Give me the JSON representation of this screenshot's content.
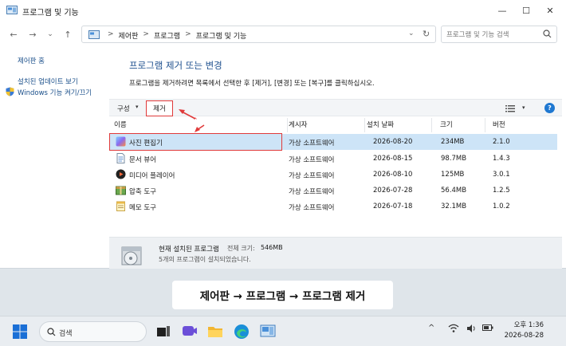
{
  "window": {
    "title": "프로그램 및 기능",
    "minimize_glyph": "—",
    "maximize_glyph": "☐",
    "close_glyph": "✕"
  },
  "nav": {
    "back_glyph": "←",
    "forward_glyph": "→",
    "recent_glyph": "⌄",
    "up_glyph": "↑",
    "breadcrumbs": [
      "제어판",
      "프로그램",
      "프로그램 및 기능"
    ],
    "separator": ">",
    "dropdown_glyph": "⌄",
    "refresh_glyph": "↻",
    "search_placeholder": "프로그램 및 기능 검색"
  },
  "sidebar": {
    "items": [
      {
        "label": "제어판 홈"
      },
      {
        "label": "설치된 업데이트 보기"
      },
      {
        "label": "Windows 기능 켜기/끄기"
      }
    ]
  },
  "main": {
    "heading": "프로그램 제거 또는 변경",
    "description": "프로그램을 제거하려면 목록에서 선택한 후 [제거], [변경] 또는 [복구]를 클릭하십시오.",
    "toolbar": {
      "organize_label": "구성",
      "remove_label": "제거",
      "help_label": "?"
    },
    "columns": [
      "이름",
      "게시자",
      "설치 날짜",
      "크기",
      "버전"
    ],
    "programs": [
      {
        "name": "사진 편집기",
        "publisher": "가상 소프트웨어",
        "date": "2026-08-20",
        "size": "234MB",
        "version": "2.1.0",
        "icon": "photo-editor-icon"
      },
      {
        "name": "문서 뷰어",
        "publisher": "가상 소프트웨어",
        "date": "2026-08-15",
        "size": "98.7MB",
        "version": "1.4.3",
        "icon": "document-viewer-icon"
      },
      {
        "name": "미디어 플레이어",
        "publisher": "가상 소프트웨어",
        "date": "2026-08-10",
        "size": "125MB",
        "version": "3.0.1",
        "icon": "media-player-icon"
      },
      {
        "name": "압축 도구",
        "publisher": "가상 소프트웨어",
        "date": "2026-07-28",
        "size": "56.4MB",
        "version": "1.2.5",
        "icon": "archive-tool-icon"
      },
      {
        "name": "메모 도구",
        "publisher": "가상 소프트웨어",
        "date": "2026-07-18",
        "size": "32.1MB",
        "version": "1.0.2",
        "icon": "memo-tool-icon"
      }
    ],
    "details": {
      "title": "현재 설치된 프로그램",
      "total_size_label": "전체 크기:",
      "total_size": "546MB",
      "count_text": "5개의 프로그램이 설치되었습니다."
    }
  },
  "caption": "제어판 → 프로그램 → 프로그램 제거",
  "taskbar": {
    "search_label": "검색",
    "tray_up_glyph": "^",
    "time": "오후 1:36",
    "date": "2026-08-28"
  },
  "colors": {
    "accent": "#1d4f8e",
    "selected_row": "#cde4f7",
    "annotation_red": "#e03a3a"
  }
}
